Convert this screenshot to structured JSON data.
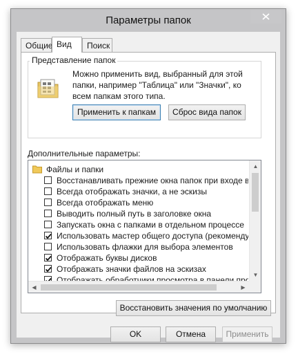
{
  "window": {
    "title": "Параметры папок"
  },
  "tabs": [
    {
      "label": "Общие"
    },
    {
      "label": "Вид"
    },
    {
      "label": "Поиск"
    }
  ],
  "folder_view": {
    "legend": "Представление папок",
    "description": "Можно применить вид, выбранный для этой папки, например \"Таблица\" или \"Значки\", ко всем папкам этого типа.",
    "apply_button": "Применить к папкам",
    "reset_button": "Сброс вида папок"
  },
  "advanced": {
    "label": "Дополнительные параметры:",
    "root": "Файлы и папки",
    "items": [
      {
        "label": "Восстанавливать прежние окна папок при входе в систему",
        "checked": false
      },
      {
        "label": "Всегда отображать значки, а не эскизы",
        "checked": false
      },
      {
        "label": "Всегда отображать меню",
        "checked": false
      },
      {
        "label": "Выводить полный путь в заголовке окна",
        "checked": false
      },
      {
        "label": "Запускать окна с папками в отдельном процессе",
        "checked": false
      },
      {
        "label": "Использовать мастер общего доступа (рекомендуется)",
        "checked": true
      },
      {
        "label": "Использовать флажки для выбора элементов",
        "checked": false
      },
      {
        "label": "Отображать буквы дисков",
        "checked": true
      },
      {
        "label": "Отображать значки файлов на эскизах",
        "checked": true
      },
      {
        "label": "Отображать обработчики просмотра в панели просмотра",
        "checked": true
      }
    ]
  },
  "restore_defaults_button": "Восстановить значения по умолчанию",
  "footer": {
    "ok": "OK",
    "cancel": "Отмена",
    "apply": "Применить"
  }
}
